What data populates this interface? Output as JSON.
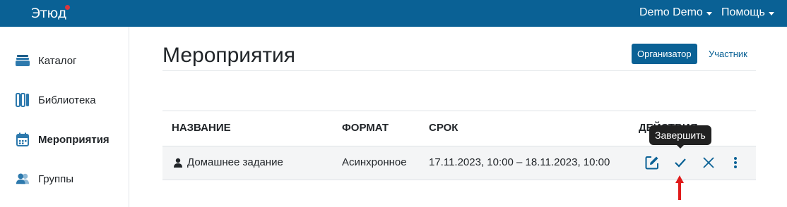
{
  "header": {
    "logo_text": "Этюд",
    "user_menu": "Demo Demo",
    "help_menu": "Помощь",
    "background_color": "#0a6195"
  },
  "sidebar": {
    "items": [
      {
        "label": "Каталог",
        "icon": "catalog-icon",
        "active": false
      },
      {
        "label": "Библиотека",
        "icon": "library-icon",
        "active": false
      },
      {
        "label": "Мероприятия",
        "icon": "calendar-icon",
        "active": true
      },
      {
        "label": "Группы",
        "icon": "users-icon",
        "active": false
      }
    ]
  },
  "main": {
    "title": "Мероприятия",
    "roles": {
      "organizer": "Организатор",
      "participant": "Участник",
      "selected": "Организатор"
    },
    "table": {
      "columns": [
        "НАЗВАНИЕ",
        "ФОРМАТ",
        "СРОК",
        "ДЕЙСТВИЯ"
      ],
      "rows": [
        {
          "name": "Домашнее задание",
          "format": "Асинхронное",
          "period": "17.11.2023, 10:00 – 18.11.2023, 10:00",
          "actions": [
            "edit-icon",
            "check-icon",
            "close-icon",
            "more-vertical-icon"
          ]
        }
      ]
    },
    "tooltip": "Завершить"
  },
  "colors": {
    "primary": "#0a6195",
    "annotation_arrow": "#e01b1b"
  }
}
